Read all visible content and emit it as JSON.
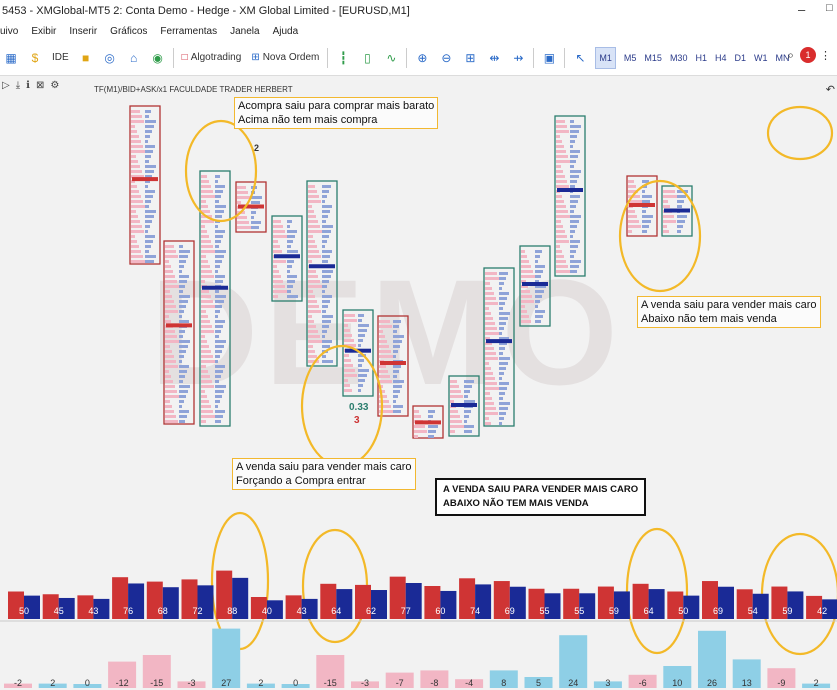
{
  "window": {
    "title": "5453 - XMGlobal-MT5 2: Conta Demo - Hedge - XM Global Limited - [EURUSD,M1]",
    "minimize": "–",
    "maximize": "□"
  },
  "menu": [
    "uivo",
    "Exibir",
    "Inserir",
    "Gráficos",
    "Ferramentas",
    "Janela",
    "Ajuda"
  ],
  "toolbar": {
    "ide_label": "IDE",
    "algotrading_label": "Algotrading",
    "new_order_label": "Nova Ordem",
    "timeframes": [
      "M1",
      "M5",
      "M15",
      "M30",
      "H1",
      "H4",
      "D1",
      "W1",
      "MN"
    ],
    "active_timeframe": "M1",
    "notification_count": "1"
  },
  "chart": {
    "label": "TF(M1)/BID+ASK/x1  FACULDADE TRADER HERBERT",
    "watermark": "DEMO",
    "candle_marks": [
      "2",
      "0.33",
      "3"
    ]
  },
  "annotations": {
    "top_left": [
      "Acompra saiu para comprar mais barato",
      "Acima não tem mais compra"
    ],
    "right": [
      "A venda saiu para vender mais caro",
      "Abaixo não tem mais venda"
    ],
    "mid": [
      "A venda saiu para vender mais caro",
      "Forçando a Compra entrar"
    ],
    "boxed": [
      "A VENDA SAIU PARA VENDER MAIS CARO",
      "ABAIXO NÃO TEM MAIS VENDA"
    ]
  },
  "volume_pairs": {
    "labels": [
      "50",
      "45",
      "43",
      "76",
      "68",
      "72",
      "88",
      "40",
      "43",
      "64",
      "62",
      "77",
      "60",
      "74",
      "69",
      "55",
      "55",
      "59",
      "64",
      "50",
      "69",
      "54",
      "59",
      "42"
    ]
  },
  "delta": {
    "labels": [
      "-2",
      "2",
      "0",
      "-12",
      "-15",
      "-3",
      "27",
      "2",
      "0",
      "-15",
      "-3",
      "-7",
      "-8",
      "-4",
      "8",
      "5",
      "24",
      "3",
      "-6",
      "10",
      "26",
      "13",
      "-9",
      "2"
    ]
  },
  "colors": {
    "sell": "#cf3434",
    "buy": "#1a2a96",
    "delta_positive": "#8ecfe6",
    "delta_negative": "#f2b6c4",
    "highlight": "#f3b928",
    "candle_up": "#2a7d6d",
    "candle_down": "#b13434"
  }
}
